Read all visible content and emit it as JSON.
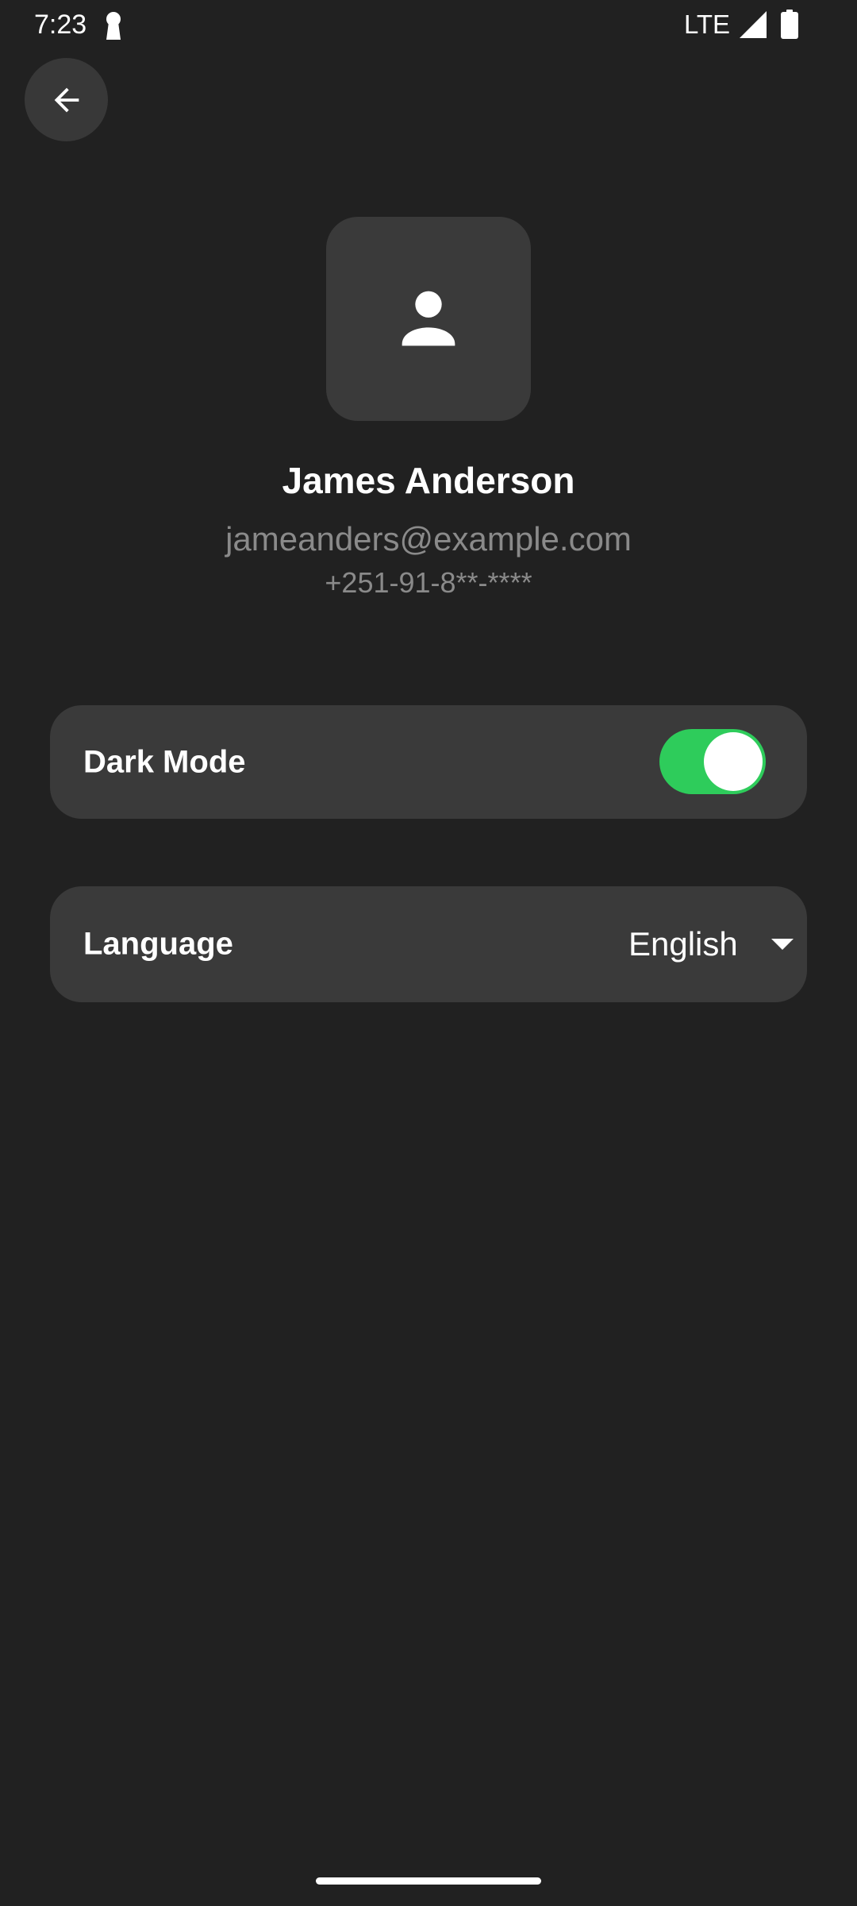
{
  "status_bar": {
    "time": "7:23",
    "network": "LTE",
    "icons": [
      "keyhole-icon",
      "signal-icon",
      "battery-icon"
    ]
  },
  "header": {
    "back_icon": "arrow-left-icon"
  },
  "profile": {
    "avatar_icon": "person-icon",
    "name": "James Anderson",
    "email": "jameanders@example.com",
    "phone": "+251-91-8**-****"
  },
  "settings": {
    "dark_mode": {
      "label": "Dark Mode",
      "enabled": true
    },
    "language": {
      "label": "Language",
      "value": "English",
      "icon": "dropdown-arrow-icon"
    }
  },
  "colors": {
    "background": "#212121",
    "card": "#3a3a3a",
    "accent": "#2ecc5b",
    "secondary_text": "#8a8a8a"
  }
}
